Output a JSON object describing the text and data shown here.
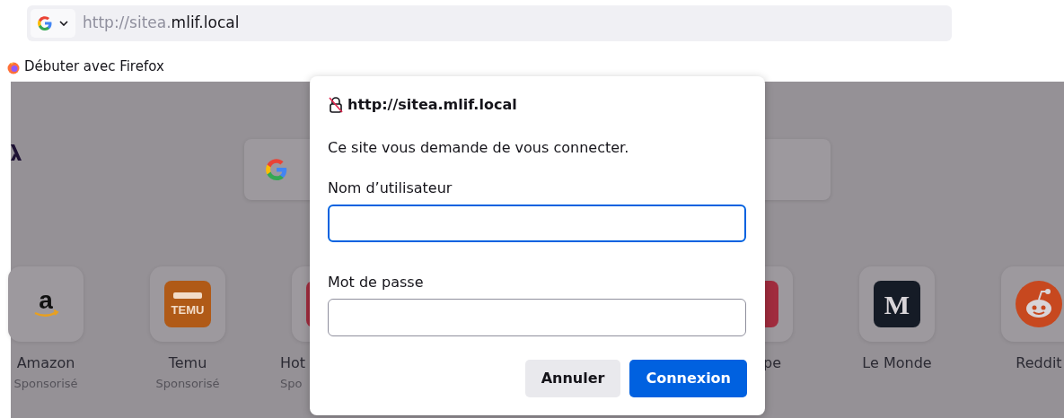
{
  "address_bar": {
    "url_faded": "http://sitea.",
    "url_host": "mlif.local"
  },
  "bookmarks": [
    {
      "label": "Débuter avec Firefox"
    }
  ],
  "new_tab": {
    "shortcuts_left": [
      {
        "label": "Amazon",
        "sublabel": "Sponsorisé",
        "kind": "amazon",
        "icon_text": "a"
      },
      {
        "label": "Temu",
        "sublabel": "Sponsorisé",
        "kind": "temu",
        "icon_text": "TEMU"
      },
      {
        "label": "Hot",
        "sublabel": "Spo",
        "kind": "plain"
      }
    ],
    "shortcuts_right": [
      {
        "label": "pe",
        "kind": "plain"
      },
      {
        "label": "Le Monde",
        "kind": "monde",
        "icon_text": "M"
      },
      {
        "label": "Reddit",
        "kind": "reddit"
      }
    ]
  },
  "dialog": {
    "title": "http://sitea.mlif.local",
    "message": "Ce site vous demande de vous connecter.",
    "fields": [
      {
        "label": "Nom d’utilisateur",
        "focused": true
      },
      {
        "label": "Mot de passe",
        "focused": false
      }
    ],
    "buttons": [
      {
        "label": "Annuler",
        "kind": "secondary"
      },
      {
        "label": "Connexion",
        "kind": "primary"
      }
    ]
  }
}
